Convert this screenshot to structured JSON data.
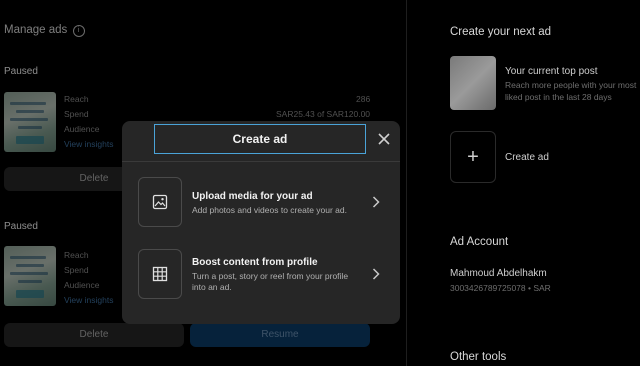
{
  "manage": {
    "title": "Manage ads",
    "info_icon": "info-icon",
    "ad1": {
      "status": "Paused",
      "reach_label": "Reach",
      "reach_value": "286",
      "spend_label": "Spend",
      "spend_value": "SAR25.43 of SAR120.00",
      "audience_label": "Audience",
      "view_insights": "View insights",
      "delete_label": "Delete"
    },
    "ad2": {
      "status": "Paused",
      "reach_label": "Reach",
      "spend_label": "Spend",
      "audience_label": "Audience",
      "view_insights": "View insights",
      "delete_label": "Delete",
      "resume_label": "Resume"
    }
  },
  "right": {
    "create_next_title": "Create your next ad",
    "top_post_title": "Your current top post",
    "top_post_desc_1": "Reach more people with your most",
    "top_post_desc_2": "liked post in the last 28 days",
    "create_ad_label": "Create ad",
    "ad_account_title": "Ad Account",
    "account_name": "Mahmoud Abdelhakm",
    "account_id": "3003426789725078 • SAR",
    "other_tools_title": "Other tools"
  },
  "modal": {
    "title": "Create ad",
    "close_icon": "close-icon",
    "option1_title": "Upload media for your ad",
    "option1_desc": "Add photos and videos to create your ad.",
    "option1_icon": "image-icon",
    "option2_title": "Boost content from profile",
    "option2_desc_1": "Turn a post, story or reel from your profile",
    "option2_desc_2": "into an ad.",
    "option2_icon": "grid-icon"
  },
  "colors": {
    "background": "#000000",
    "modal_bg": "#262626",
    "title_border": "#4aa3d8",
    "resume_button": "#0b3c66"
  }
}
